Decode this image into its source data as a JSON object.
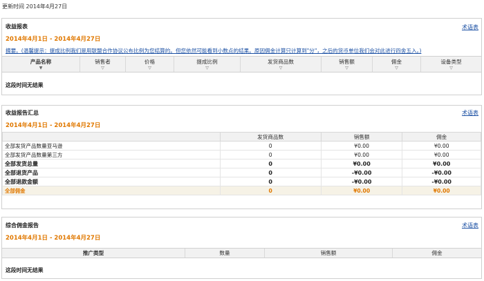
{
  "updated": "更新时间 2014年4月27日",
  "earnings": {
    "title": "收益报表",
    "glossary": "术语表",
    "date_range": "2014年4月1日 - 2014年4月27日",
    "notice": "摘要。(温馨提示：提成比例我们是用联盟合作协议公布比例为您结算的。但您依然可能看到小数点的结果。原因佣金计算只计算到\"分\"，之后的货币单位我们会对此进行四舍五入。)",
    "columns": [
      "产品名称",
      "销售者",
      "价格",
      "提成比例",
      "发货商品数",
      "销售额",
      "佣金",
      "设备类型"
    ],
    "empty": "这段时间无结果"
  },
  "summary": {
    "title": "收益报告汇总",
    "glossary": "术语表",
    "date_range": "2014年4月1日 - 2014年4月27日",
    "columns": [
      "",
      "发货商品数",
      "销售额",
      "佣金"
    ],
    "rows": [
      {
        "label": "全部发货产品数量亚马逊",
        "qty": "0",
        "sales": "¥0.00",
        "fee": "¥0.00"
      },
      {
        "label": "全部发货产品数量第三方",
        "qty": "0",
        "sales": "¥0.00",
        "fee": "¥0.00"
      },
      {
        "label": "全部发货总量",
        "qty": "0",
        "sales": "¥0.00",
        "fee": "¥0.00"
      },
      {
        "label": "全部退货产品",
        "qty": "0",
        "sales": "-¥0.00",
        "fee": "-¥0.00"
      },
      {
        "label": "全部退款金额",
        "qty": "0",
        "sales": "-¥0.00",
        "fee": "-¥0.00"
      },
      {
        "label": "全部佣金",
        "qty": "0",
        "sales": "¥0.00",
        "fee": "¥0.00"
      }
    ]
  },
  "comprehensive": {
    "title": "综合佣金报告",
    "glossary": "术语表",
    "date_range": "2014年4月1日 - 2014年4月27日",
    "columns": [
      "推广类型",
      "数量",
      "销售额",
      "佣金"
    ],
    "empty": "这段时间无结果"
  },
  "colors": {
    "accent": "#e07800",
    "link": "#1a4fa3",
    "header_bg": "#f1f1f1",
    "total_bg": "#f6f2e6"
  },
  "icons": {
    "sort": "sort-down-arrow-icon"
  }
}
